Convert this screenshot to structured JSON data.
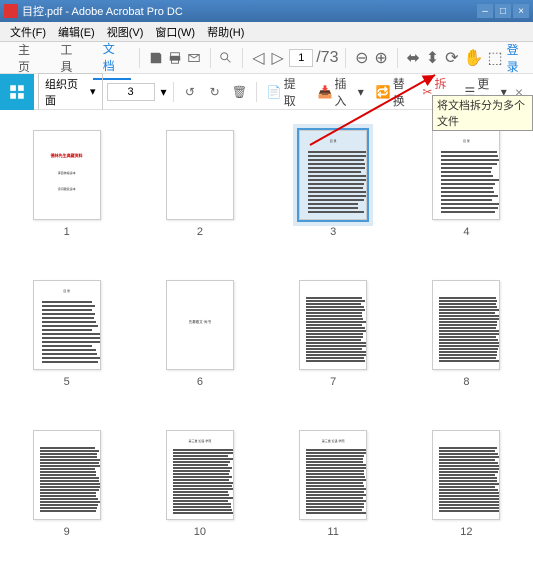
{
  "window": {
    "title": "目控.pdf - Adobe Acrobat Pro DC",
    "minimize": "–",
    "maximize": "□",
    "close": "×"
  },
  "menu": {
    "file": "文件(F)",
    "edit": "编辑(E)",
    "view": "视图(V)",
    "window": "窗口(W)",
    "help": "帮助(H)"
  },
  "tabs": {
    "home": "主页",
    "tools": "工具",
    "document": "文档"
  },
  "toolbar1": {
    "page_value": "1",
    "login": "登录"
  },
  "toolbar2": {
    "organize": "组织页面",
    "page_input": "3",
    "extract": "提取",
    "insert": "插入",
    "replace": "替换",
    "split": "拆分",
    "more": "更多",
    "close": "×"
  },
  "tooltip": "将文档拆分为多个文件",
  "thumbs": [
    {
      "label": "1",
      "type": "cover",
      "title": "德林先生典藏资料",
      "sub1": "译自种编读本",
      "sub2": "诗词歌赋读本"
    },
    {
      "label": "2",
      "type": "blank"
    },
    {
      "label": "3",
      "type": "toc",
      "selected": true
    },
    {
      "label": "4",
      "type": "toc"
    },
    {
      "label": "5",
      "type": "toc"
    },
    {
      "label": "6",
      "type": "heading",
      "text": "先秦散文·尚书"
    },
    {
      "label": "7",
      "type": "body"
    },
    {
      "label": "8",
      "type": "body"
    },
    {
      "label": "9",
      "type": "body"
    },
    {
      "label": "10",
      "type": "body",
      "heading": true
    },
    {
      "label": "11",
      "type": "body",
      "heading": true
    },
    {
      "label": "12",
      "type": "body"
    }
  ]
}
